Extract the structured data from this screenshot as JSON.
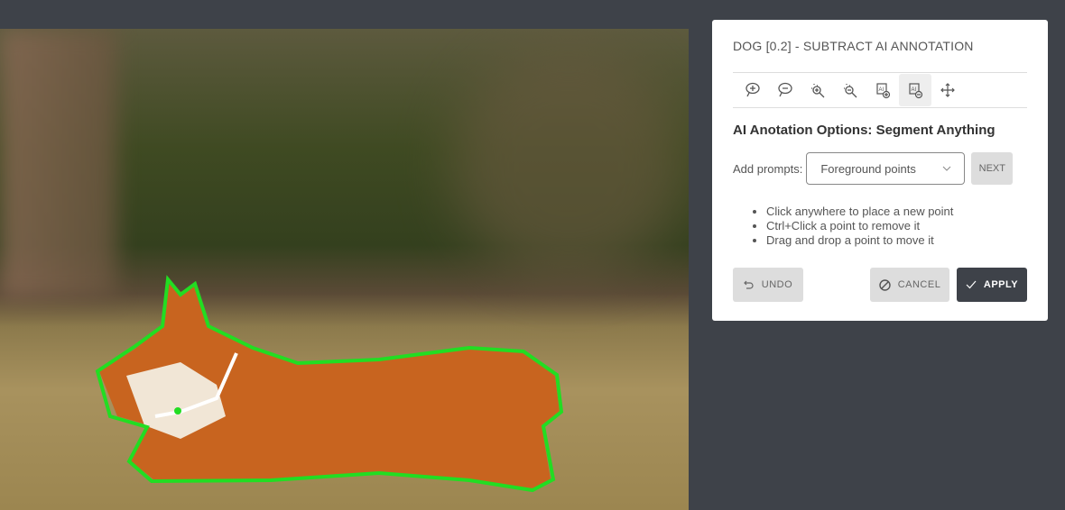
{
  "panel": {
    "title": "DOG [0.2] - SUBTRACT AI ANNOTATION",
    "heading": "AI Anotation Options: Segment Anything",
    "prompts_label": "Add prompts:",
    "prompt_select": "Foreground points",
    "next": "NEXT",
    "instructions": [
      "Click anywhere to place a new point",
      "Ctrl+Click a point to remove it",
      "Drag and drop a point to move it"
    ],
    "undo": "UNDO",
    "cancel": "CANCEL",
    "apply": "APPLY"
  },
  "tools": [
    "add-polygon-icon",
    "subtract-polygon-icon",
    "magic-add-icon",
    "magic-subtract-icon",
    "ai-add-icon",
    "ai-subtract-icon",
    "move-icon"
  ],
  "colors": {
    "outline": "#22dd22",
    "dark": "#3e4249"
  }
}
